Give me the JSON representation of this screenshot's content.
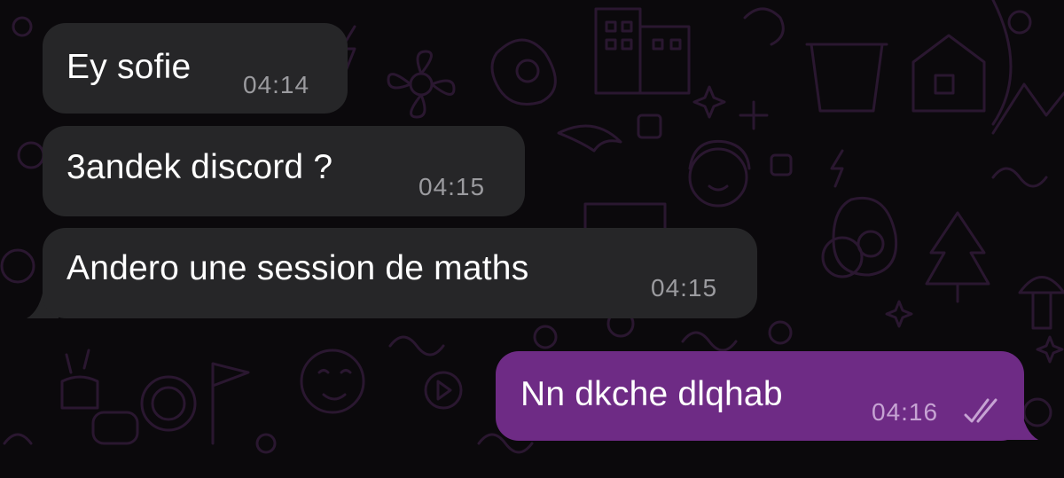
{
  "theme": {
    "background": "#0b090c",
    "wallpaper_line": "#2a1730",
    "incoming_bubble": "#262628",
    "outgoing_bubble": "#6e2b85",
    "incoming_time": "#9b9b9f",
    "outgoing_time": "#c6a3d3"
  },
  "messages": [
    {
      "direction": "incoming",
      "text": "Ey sofie",
      "time": "04:14"
    },
    {
      "direction": "incoming",
      "text": "3andek discord ?",
      "time": "04:15"
    },
    {
      "direction": "incoming",
      "text": "Andero une session de maths",
      "time": "04:15"
    },
    {
      "direction": "outgoing",
      "text": "Nn dkche dlqhab",
      "time": "04:16",
      "status_icon": "double-check-read-icon"
    }
  ]
}
